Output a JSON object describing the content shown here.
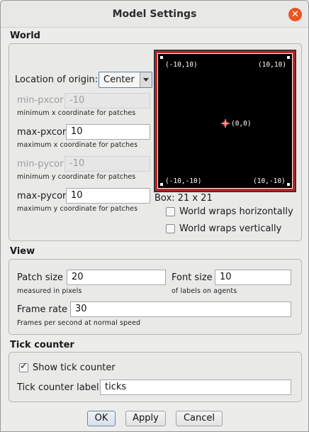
{
  "window": {
    "title": "Model Settings",
    "close_glyph": "✕"
  },
  "world": {
    "heading": "World",
    "origin_label": "Location of origin:",
    "origin_value": "Center",
    "min_pxcor": {
      "label": "min-pxcor",
      "value": "-10",
      "hint": "minimum x coordinate for patches"
    },
    "max_pxcor": {
      "label": "max-pxcor",
      "value": "10",
      "hint": "maximum x coordinate for patches"
    },
    "min_pycor": {
      "label": "min-pycor",
      "value": "-10",
      "hint": "minimum y coordinate for patches"
    },
    "max_pycor": {
      "label": "max-pycor",
      "value": "10",
      "hint": "maximum y coordinate for patches"
    },
    "preview": {
      "top_left": "(-10,10)",
      "top_right": "(10,10)",
      "center": "(0,0)",
      "bottom_left": "(-10,-10)",
      "bottom_right": "(10,-10)",
      "border_color": "#c72222",
      "background_color": "#000000"
    },
    "box_label": "Box: 21 x 21",
    "wrap_horizontal": {
      "label": "World wraps horizontally",
      "checked": false
    },
    "wrap_vertical": {
      "label": "World wraps vertically",
      "checked": false
    }
  },
  "view": {
    "heading": "View",
    "patch_size": {
      "label": "Patch size",
      "value": "20",
      "hint": "measured in pixels"
    },
    "font_size": {
      "label": "Font size",
      "value": "10",
      "hint": "of labels on agents"
    },
    "frame_rate": {
      "label": "Frame rate",
      "value": "30",
      "hint": "Frames per second at normal speed"
    }
  },
  "tick_counter": {
    "heading": "Tick counter",
    "show": {
      "label": "Show tick counter",
      "checked": true
    },
    "label_field": {
      "label": "Tick counter label",
      "value": "ticks"
    }
  },
  "buttons": {
    "ok": "OK",
    "apply": "Apply",
    "cancel": "Cancel"
  },
  "colors": {
    "close_button": "#e95420",
    "window_bg": "#ececeb"
  }
}
